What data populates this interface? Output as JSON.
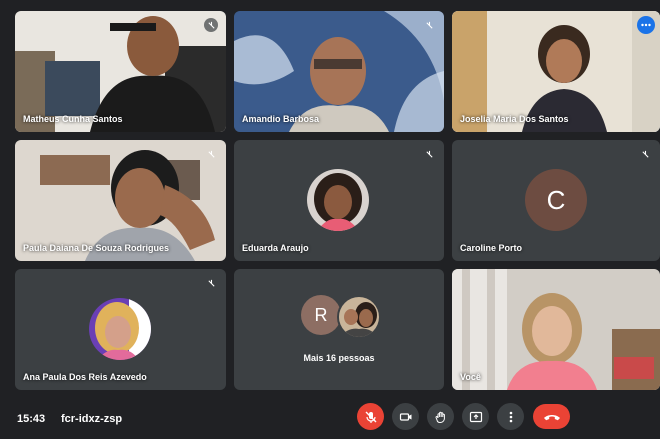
{
  "participants": [
    {
      "name": "Matheus Cunha Santos"
    },
    {
      "name": "Amandio Barbosa"
    },
    {
      "name": "Joselia Maria Dos Santos"
    },
    {
      "name": "Paula Daiana De Souza Rodrigues"
    },
    {
      "name": "Eduarda Araujo"
    },
    {
      "name": "Caroline Porto",
      "initial": "C"
    },
    {
      "name": "Ana Paula Dos Reis Azevedo"
    },
    {
      "more_label": "Mais 16 pessoas",
      "initial": "R"
    },
    {
      "name": "Você"
    }
  ],
  "toolbar": {
    "time": "15:43",
    "meeting_code": "fcr-idxz-zsp"
  },
  "colors": {
    "background": "#202124",
    "tile": "#3c4043",
    "active_border": "#8ab4f8",
    "danger": "#ea4335",
    "avatar_c": "#6d4c41",
    "avatar_r": "#8d6e63"
  }
}
